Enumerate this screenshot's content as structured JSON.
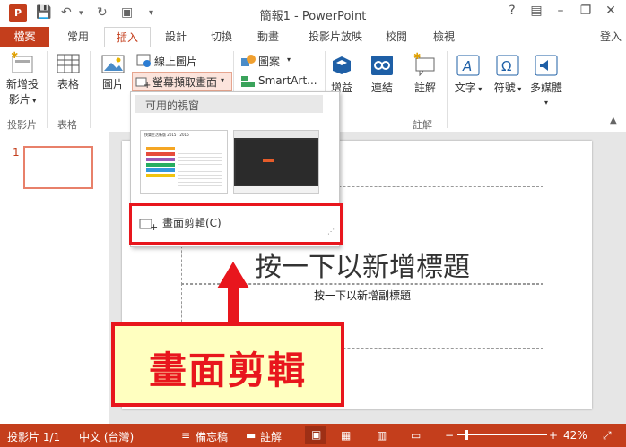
{
  "window": {
    "title": "簡報1 - PowerPoint",
    "help": "?",
    "signin": "登入"
  },
  "tabs": [
    {
      "label": "檔案"
    },
    {
      "label": "常用"
    },
    {
      "label": "插入"
    },
    {
      "label": "設計"
    },
    {
      "label": "切換"
    },
    {
      "label": "動畫"
    },
    {
      "label": "投影片放映"
    },
    {
      "label": "校閱"
    },
    {
      "label": "檢視"
    }
  ],
  "ribbon": {
    "new_slide": {
      "line1": "新增投",
      "line2": "影片"
    },
    "table": "表格",
    "picture": "圖片",
    "online_picture": "線上圖片",
    "screenshot": "螢幕擷取畫面",
    "shapes": "圖案",
    "smartart": "SmartArt...",
    "addins": "增益",
    "links": "連結",
    "comment": "註解",
    "text": "文字",
    "symbols": "符號",
    "media": "多媒體",
    "groups": {
      "slides": "投影片",
      "tables": "表格",
      "comments": "註解"
    }
  },
  "dropdown": {
    "header": "可用的視窗",
    "thumb1_caption": "快樂生活新版 2015 - 2016",
    "clipping_label": "畫面剪輯(C)"
  },
  "slide": {
    "title_placeholder": "按一下以新增標題",
    "subtitle_placeholder": "按一下以新增副標題"
  },
  "thumb_panel": {
    "number": "1"
  },
  "annotation": {
    "text": "畫面剪輯"
  },
  "status": {
    "slide_count": "投影片 1/1",
    "language": "中文 (台灣)",
    "notes": "備忘稿",
    "comments": "註解",
    "zoom": "42%"
  },
  "colors": {
    "accent": "#c43e1c",
    "callout_bg": "#ffffc0",
    "callout_border": "#e8161d"
  }
}
